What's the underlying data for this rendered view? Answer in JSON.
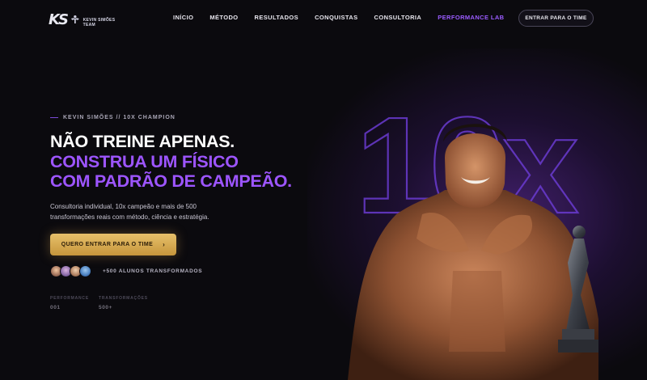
{
  "header": {
    "logo_mark": "KS",
    "logo_text_1": "KEVIN SIMÕES TEAM",
    "nav": [
      {
        "label": "INÍCIO"
      },
      {
        "label": "MÉTODO"
      },
      {
        "label": "RESULTADOS"
      },
      {
        "label": "CONQUISTAS"
      },
      {
        "label": "CONSULTORIA"
      },
      {
        "label": "PERFORMANCE LAB"
      }
    ],
    "cta_label": "ENTRAR PARA O TIME"
  },
  "hero": {
    "eyebrow": "KEVIN SIMÕES // 10X CHAMPION",
    "title_line1": "NÃO TREINE APENAS.",
    "title_line2": "CONSTRUA UM FÍSICO",
    "title_line3": "COM PADRÃO DE CAMPEÃO.",
    "description": "Consultoria individual, 10x campeão e mais de 500 transformações reais com método, ciência e estratégia.",
    "cta_label": "QUERO ENTRAR PARA O TIME",
    "cta_icon": "chevron-right-icon",
    "students_label": "+500 ALUNOS TRANSFORMADOS",
    "background_text": "10x"
  },
  "stats": [
    {
      "label": "PERFORMANCE",
      "value": "001"
    },
    {
      "label": "TRANSFORMAÇÕES",
      "value": "500+"
    }
  ],
  "colors": {
    "background": "#0b0a0e",
    "accent_purple": "#9d55ff",
    "cta_gold": "#e7c06a"
  }
}
